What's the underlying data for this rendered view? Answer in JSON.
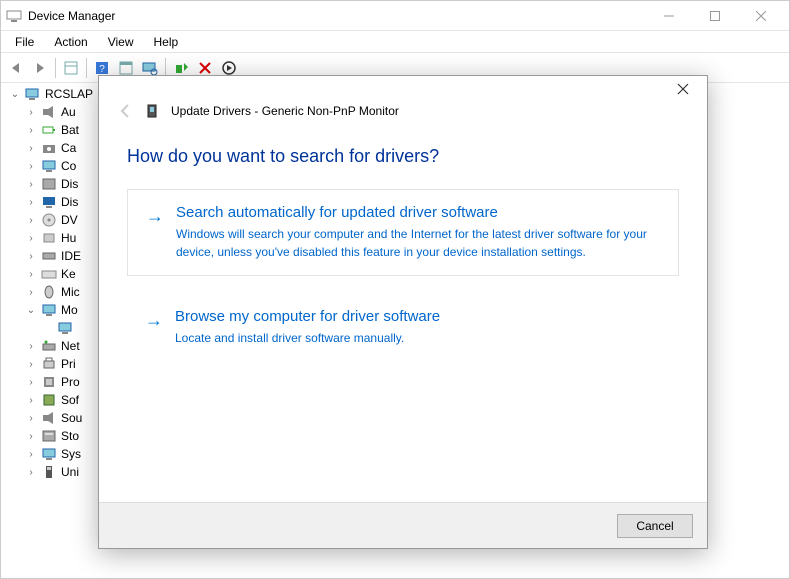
{
  "titlebar": {
    "title": "Device Manager"
  },
  "menubar": [
    "File",
    "Action",
    "View",
    "Help"
  ],
  "tree": {
    "root": "RCSLAP",
    "items": [
      {
        "label": "Au",
        "chev": ">",
        "icon": "sound"
      },
      {
        "label": "Bat",
        "chev": ">",
        "icon": "battery"
      },
      {
        "label": "Ca",
        "chev": ">",
        "icon": "camera"
      },
      {
        "label": "Co",
        "chev": ">",
        "icon": "computer"
      },
      {
        "label": "Dis",
        "chev": ">",
        "icon": "disk"
      },
      {
        "label": "Dis",
        "chev": ">",
        "icon": "display"
      },
      {
        "label": "DV",
        "chev": ">",
        "icon": "dvd"
      },
      {
        "label": "Hu",
        "chev": ">",
        "icon": "hid"
      },
      {
        "label": "IDE",
        "chev": ">",
        "icon": "ide"
      },
      {
        "label": "Ke",
        "chev": ">",
        "icon": "keyboard"
      },
      {
        "label": "Mic",
        "chev": ">",
        "icon": "mouse"
      },
      {
        "label": "Mo",
        "chev": "v",
        "icon": "monitor",
        "expanded": true
      },
      {
        "label": "",
        "chev": "",
        "icon": "monitor",
        "selected": true,
        "child": true
      },
      {
        "label": "Net",
        "chev": ">",
        "icon": "network"
      },
      {
        "label": "Pri",
        "chev": ">",
        "icon": "print"
      },
      {
        "label": "Pro",
        "chev": ">",
        "icon": "cpu"
      },
      {
        "label": "Sof",
        "chev": ">",
        "icon": "soft"
      },
      {
        "label": "Sou",
        "chev": ">",
        "icon": "sound2"
      },
      {
        "label": "Sto",
        "chev": ">",
        "icon": "storage"
      },
      {
        "label": "Sys",
        "chev": ">",
        "icon": "system"
      },
      {
        "label": "Uni",
        "chev": ">",
        "icon": "usb"
      }
    ]
  },
  "dialog": {
    "title": "Update Drivers - Generic Non-PnP Monitor",
    "heading": "How do you want to search for drivers?",
    "option1": {
      "title": "Search automatically for updated driver software",
      "desc": "Windows will search your computer and the Internet for the latest driver software for your device, unless you've disabled this feature in your device installation settings."
    },
    "option2": {
      "title": "Browse my computer for driver software",
      "desc": "Locate and install driver software manually."
    },
    "cancel": "Cancel"
  }
}
